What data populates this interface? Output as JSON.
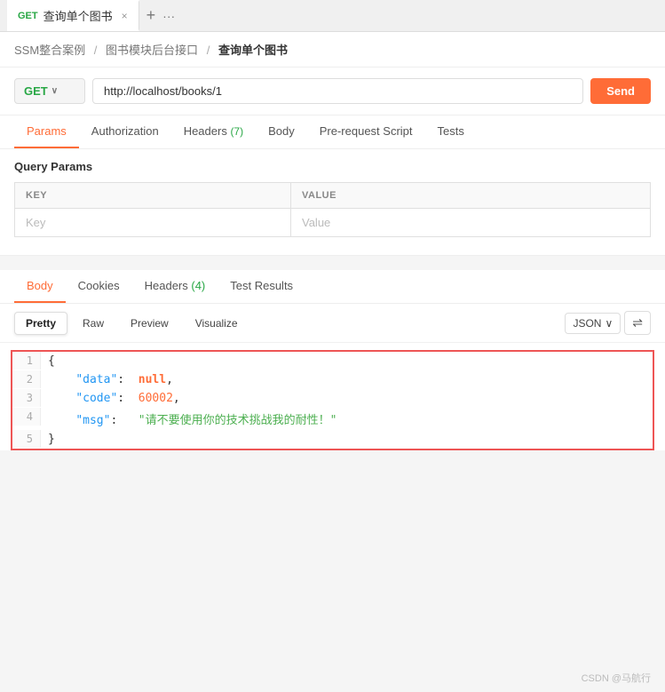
{
  "tab": {
    "method_badge": "GET",
    "title": "查询单个图书",
    "close_icon": "×",
    "add_icon": "+",
    "more_icon": "···"
  },
  "breadcrumb": {
    "part1": "SSM整合案例",
    "sep1": "/",
    "part2": "图书模块后台接口",
    "sep2": "/",
    "current": "查询单个图书"
  },
  "url_bar": {
    "method": "GET",
    "chevron": "∨",
    "url": "http://localhost/books/1",
    "send_label": "Send"
  },
  "request_tabs": [
    {
      "id": "params",
      "label": "Params",
      "active": true,
      "badge": null
    },
    {
      "id": "authorization",
      "label": "Authorization",
      "active": false,
      "badge": null
    },
    {
      "id": "headers",
      "label": "Headers",
      "active": false,
      "badge": "(7)"
    },
    {
      "id": "body",
      "label": "Body",
      "active": false,
      "badge": null
    },
    {
      "id": "pre-request",
      "label": "Pre-request Script",
      "active": false,
      "badge": null
    },
    {
      "id": "tests",
      "label": "Tests",
      "active": false,
      "badge": null
    }
  ],
  "query_params": {
    "title": "Query Params",
    "columns": [
      "KEY",
      "VALUE"
    ],
    "placeholder_key": "Key",
    "placeholder_value": "Value"
  },
  "response_tabs": [
    {
      "id": "body",
      "label": "Body",
      "active": true,
      "badge": null
    },
    {
      "id": "cookies",
      "label": "Cookies",
      "active": false,
      "badge": null
    },
    {
      "id": "headers",
      "label": "Headers",
      "active": false,
      "badge": "(4)"
    },
    {
      "id": "test-results",
      "label": "Test Results",
      "active": false,
      "badge": null
    }
  ],
  "format_bar": {
    "buttons": [
      "Pretty",
      "Raw",
      "Preview",
      "Visualize"
    ],
    "active_button": "Pretty",
    "format_select": "JSON",
    "chevron": "∨",
    "wrap_icon": "⇌"
  },
  "code": {
    "lines": [
      {
        "num": "1",
        "content": "{"
      },
      {
        "num": "2",
        "content": "    \"data\":  null,"
      },
      {
        "num": "3",
        "content": "    \"code\":  60002,"
      },
      {
        "num": "4",
        "content": "    \"msg\":   \"请不要使用你的技术挑战我的耐性！\""
      },
      {
        "num": "5",
        "content": "}"
      }
    ]
  },
  "footer": {
    "text": "CSDN @马航行"
  }
}
